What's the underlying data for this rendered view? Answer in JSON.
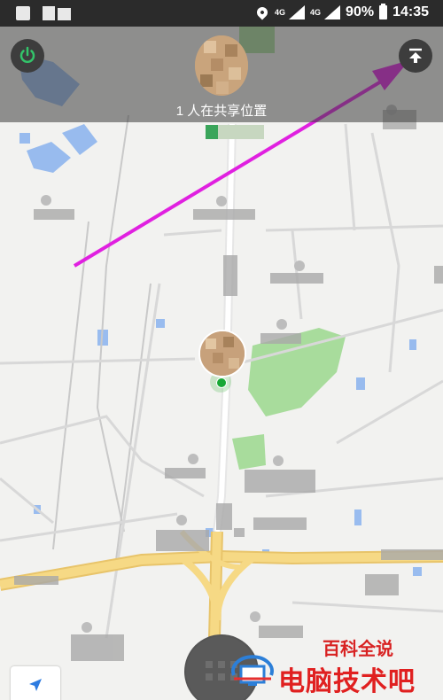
{
  "status_bar": {
    "network_1": "4G",
    "network_2": "4G",
    "battery": "90%",
    "time": "14:35"
  },
  "header": {
    "share_text": "1 人在共享位置"
  },
  "watermark": {
    "top": "百科全说",
    "bottom": "电脑技术吧"
  },
  "colors": {
    "arrow": "#e020e0",
    "road_major": "#f3d27a",
    "water": "#8fb6ee",
    "park": "#a8dc9c",
    "user_dot": "#17a835",
    "power_icon": "#33c46a"
  },
  "icons": {
    "power": "power-icon",
    "upload": "upload-to-top-icon",
    "locate": "navigation-arrow-icon",
    "compass": "compass-icon"
  }
}
